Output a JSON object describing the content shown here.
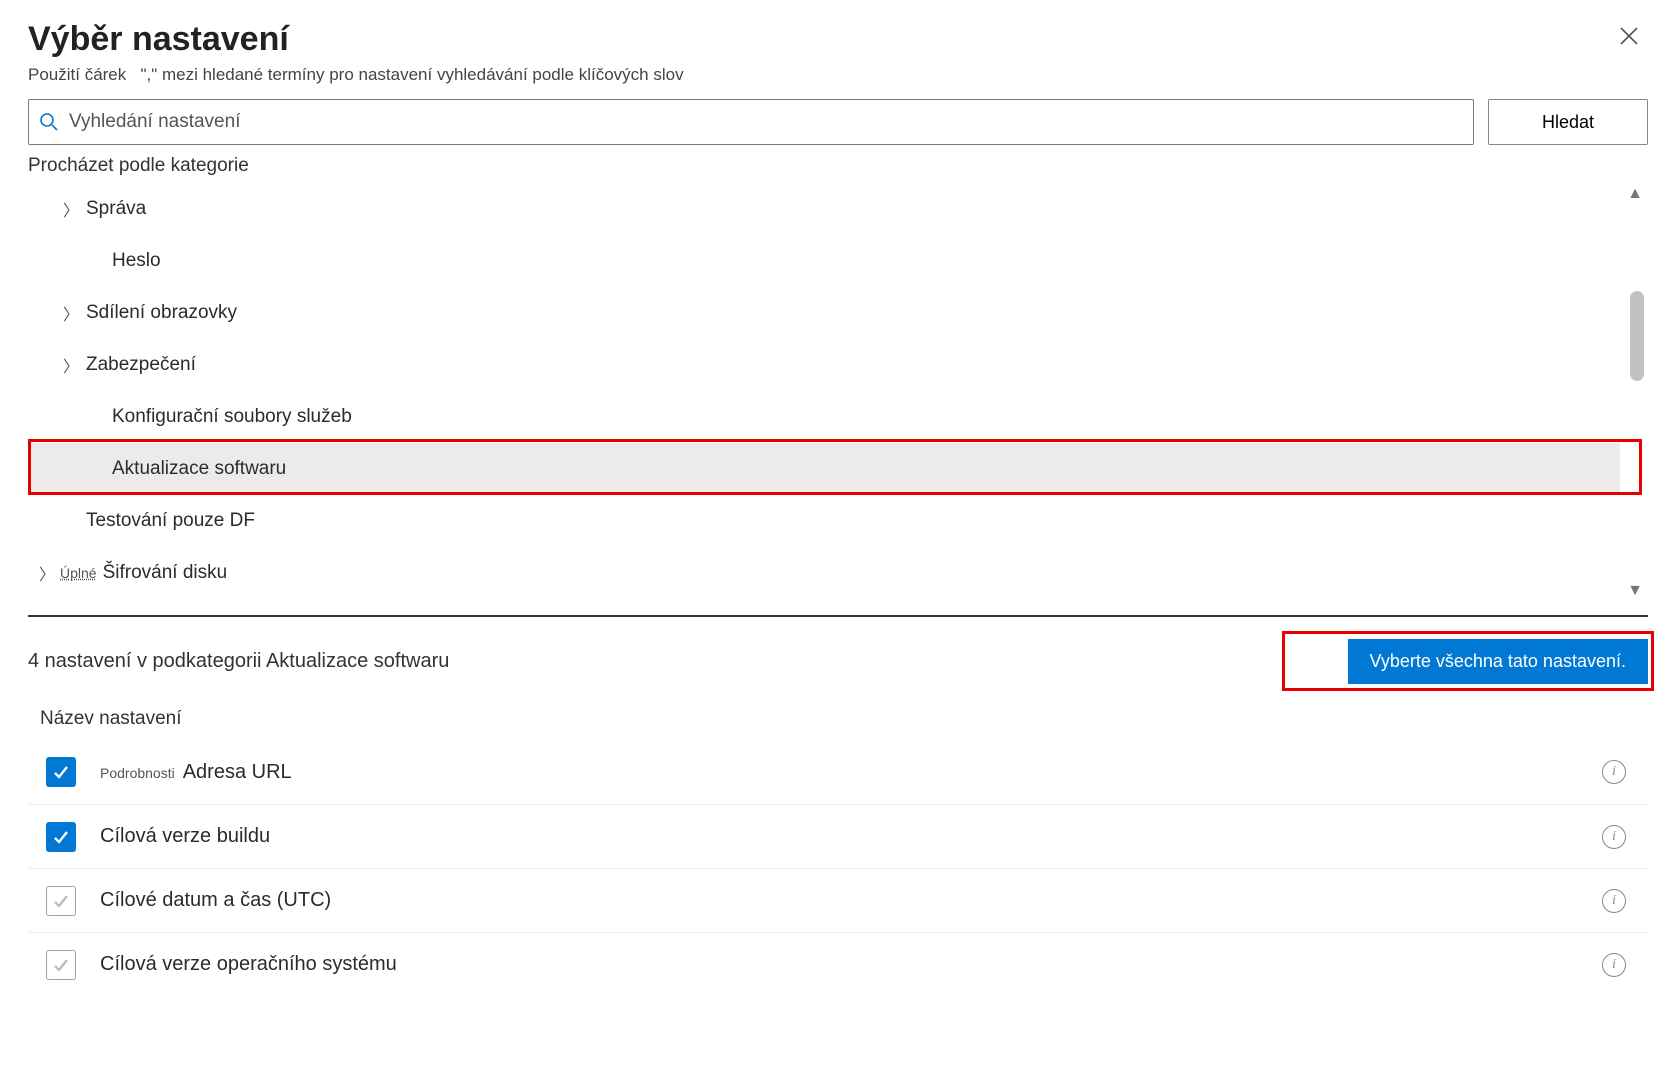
{
  "title": "Výběr nastavení",
  "hint_prefix": "Použití čárek",
  "hint_quote": "\",\"",
  "hint_suffix": "mezi hledané termíny pro nastavení vyhledávání podle klíčových slov",
  "search": {
    "placeholder": "Vyhledání nastavení",
    "button": "Hledat"
  },
  "browse_label": "Procházet podle kategorie",
  "tree": [
    {
      "label": "Správa",
      "expandable": true,
      "child": false
    },
    {
      "label": "Heslo",
      "expandable": false,
      "child": true
    },
    {
      "label": "Sdílení obrazovky",
      "expandable": true,
      "child": false
    },
    {
      "label": "Zabezpečení",
      "expandable": true,
      "child": false
    },
    {
      "label": "Konfigurační soubory služeb",
      "expandable": false,
      "child": true
    },
    {
      "label": "Aktualizace softwaru",
      "expandable": false,
      "child": true,
      "selected": true
    },
    {
      "label": "Testování pouze DF",
      "expandable": false,
      "child": false,
      "no_chevron": true
    },
    {
      "label": "Šifrování disku",
      "expandable": true,
      "child": false,
      "level0": true,
      "prefix": "Úplné"
    }
  ],
  "subcategory_text": "4 nastavení v podkategorii Aktualizace softwaru",
  "select_all": "Vyberte všechna tato nastavení.",
  "column_header": "Název nastavení",
  "settings": [
    {
      "checked": true,
      "mini": "Podrobnosti",
      "label": "Adresa URL"
    },
    {
      "checked": true,
      "label": "Cílová verze buildu"
    },
    {
      "checked": false,
      "label": "Cílové datum a čas (UTC)"
    },
    {
      "checked": false,
      "label": "Cílová verze operačního systému"
    }
  ]
}
